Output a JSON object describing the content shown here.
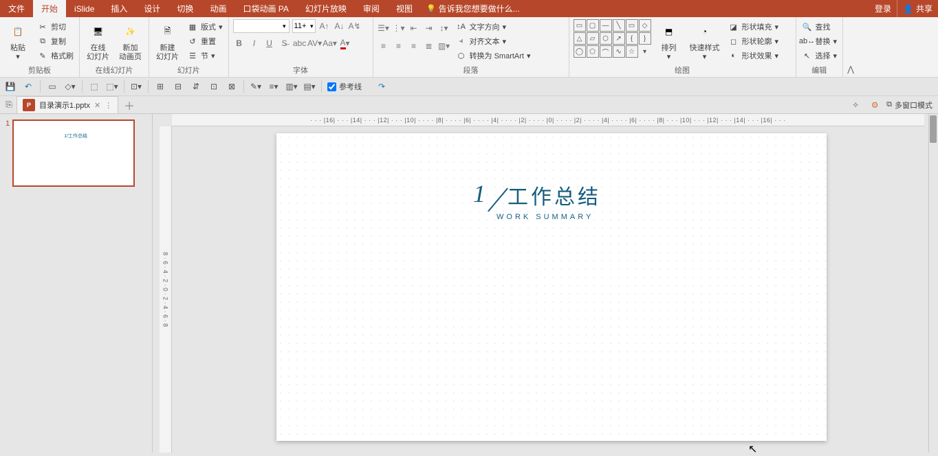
{
  "menubar": {
    "items": [
      "文件",
      "开始",
      "iSlide",
      "插入",
      "设计",
      "切换",
      "动画",
      "口袋动画 PA",
      "幻灯片放映",
      "审阅",
      "视图"
    ],
    "active_index": 1,
    "tell_me": "告诉我您想要做什么...",
    "login": "登录",
    "share": "共享"
  },
  "ribbon": {
    "clipboard": {
      "label": "剪贴板",
      "paste": "粘贴",
      "cut": "剪切",
      "copy": "复制",
      "format_painter": "格式刷"
    },
    "online_slides": {
      "label": "在线幻灯片",
      "online": "在线\n幻灯片",
      "new_anim": "新加\n动画页"
    },
    "slides": {
      "label": "幻灯片",
      "new": "新建\n幻灯片",
      "layout": "版式",
      "reset": "重置",
      "section": "节"
    },
    "font": {
      "label": "字体",
      "size": "11+"
    },
    "paragraph": {
      "label": "段落",
      "text_direction": "文字方向",
      "align_text": "对齐文本",
      "smartart": "转换为 SmartArt"
    },
    "drawing": {
      "label": "绘图",
      "arrange": "排列",
      "quick_style": "快速样式",
      "shape_fill": "形状填充",
      "shape_outline": "形状轮廓",
      "shape_effect": "形状效果"
    },
    "editing": {
      "label": "编辑",
      "find": "查找",
      "replace": "替换",
      "select": "选择"
    }
  },
  "quickbar": {
    "guideline_label": "参考线"
  },
  "tabbar": {
    "filename": "目录演示1.pptx",
    "multi_window": "多窗口模式"
  },
  "thumb": {
    "number": "1"
  },
  "slide": {
    "bignum": "1",
    "title_zh": "工作总结",
    "subtitle": "WORK SUMMARY"
  },
  "ruler": {
    "h": "· · · |16| · · · |14| · · · |12| · · · |10| · · · · |8| · · · · |6| · · · · |4| · · · · |2| · · · · |0| · · · · |2| · · · · |4| · · · · |6| · · · · |8| · · · |10| · · · |12| · · · |14| · · · |16| · · ·",
    "v": "8 · 6 · 4 · 2 · 0 · 2 · 4 · 6 · 8"
  }
}
